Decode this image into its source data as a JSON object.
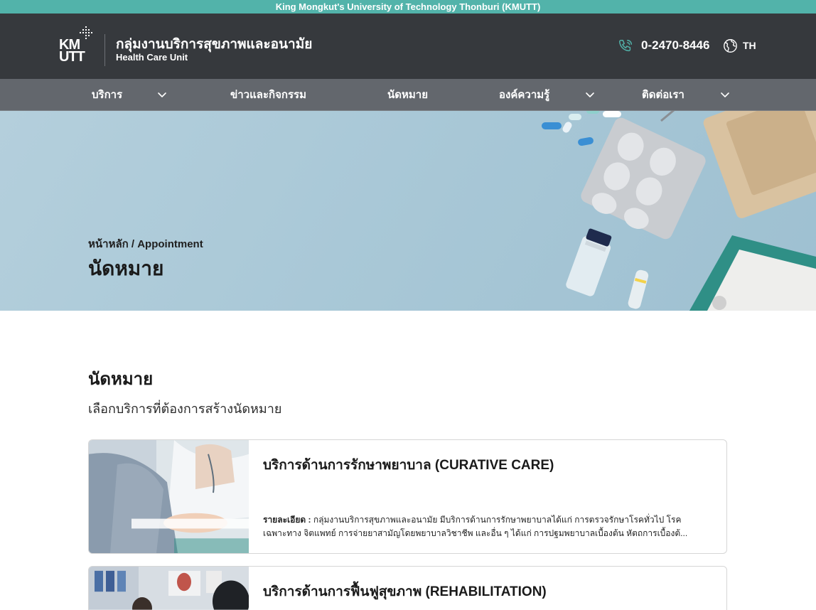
{
  "topbar": {
    "text": "King Mongkut's University of Technology Thonburi (KMUTT)"
  },
  "header": {
    "logo_text_1": "KM",
    "logo_text_2": "UTT",
    "org_title": "กลุ่มงานบริการสุขภาพและอนามัย",
    "org_subtitle": "Health Care Unit",
    "phone": "0-2470-8446",
    "lang": "TH"
  },
  "nav": {
    "items": [
      {
        "label": "บริการ",
        "has_dropdown": true
      },
      {
        "label": "ข่าวและกิจกรรม",
        "has_dropdown": false
      },
      {
        "label": "นัดหมาย",
        "has_dropdown": false
      },
      {
        "label": "องค์ความรู้",
        "has_dropdown": true
      },
      {
        "label": "ติดต่อเรา",
        "has_dropdown": true
      }
    ]
  },
  "hero": {
    "breadcrumb": "หน้าหลัก / Appointment",
    "title": "นัดหมาย"
  },
  "section": {
    "title": "นัดหมาย",
    "subtitle": "เลือกบริการที่ต้องการสร้างนัดหมาย"
  },
  "cards": [
    {
      "title": "บริการด้านการรักษาพยาบาล (CURATIVE CARE)",
      "desc_label": "รายละเอียด :",
      "desc": "กลุ่มงานบริการสุขภาพและอนามัย มีบริการด้านการรักษาพยาบาลได้แก่ การตรวจรักษาโรคทั่วไป โรคเฉพาะทาง จิตแพทย์ การจ่ายยาสามัญโดยพยาบาลวิชาชีพ และอื่น ๆ ได้แก่ การปฐมพยาบาลเบื้องต้น หัตถการเบื้องต้..."
    },
    {
      "title": "บริการด้านการฟื้นฟูสุขภาพ (REHABILITATION)"
    }
  ],
  "colors": {
    "topbar": "#52b3aa",
    "header": "#36393d",
    "nav": "#63676d",
    "accent": "#52b3aa"
  }
}
